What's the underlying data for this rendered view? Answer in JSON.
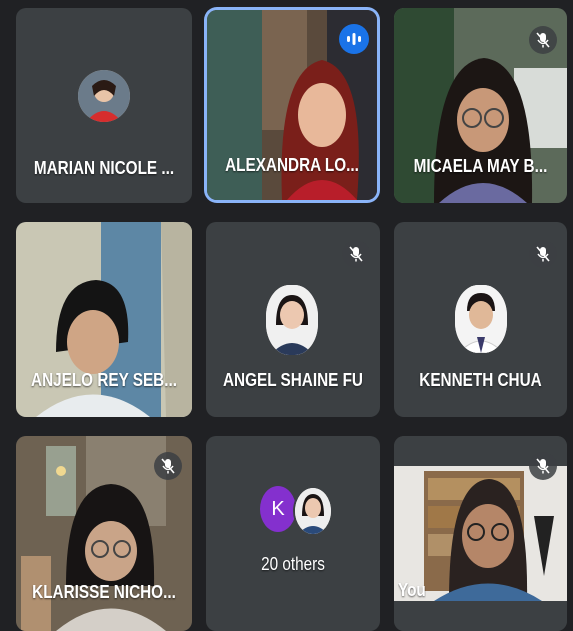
{
  "participants": [
    {
      "name": "MARIAN NICOLE ...",
      "muted": false
    },
    {
      "name": "ALEXANDRA LO...",
      "speaking": true
    },
    {
      "name": "MICAELA MAY B...",
      "muted": true
    },
    {
      "name": "ANJELO REY SEB...",
      "muted": false
    },
    {
      "name": "ANGEL SHAINE FU",
      "muted": true
    },
    {
      "name": "KENNETH CHUA",
      "muted": true
    },
    {
      "name": "KLARISSE NICHO...",
      "muted": true
    },
    {
      "name": "You",
      "muted": true
    }
  ],
  "others": {
    "initial": "K",
    "label": "20 others",
    "initial_color": "#8430ce"
  },
  "colors": {
    "background": "#202124",
    "tile": "#3c4043",
    "accent": "#1a73e8",
    "active_border": "#8ab4f8"
  },
  "icons": [
    "mic-off-icon",
    "speaking-indicator-icon"
  ]
}
